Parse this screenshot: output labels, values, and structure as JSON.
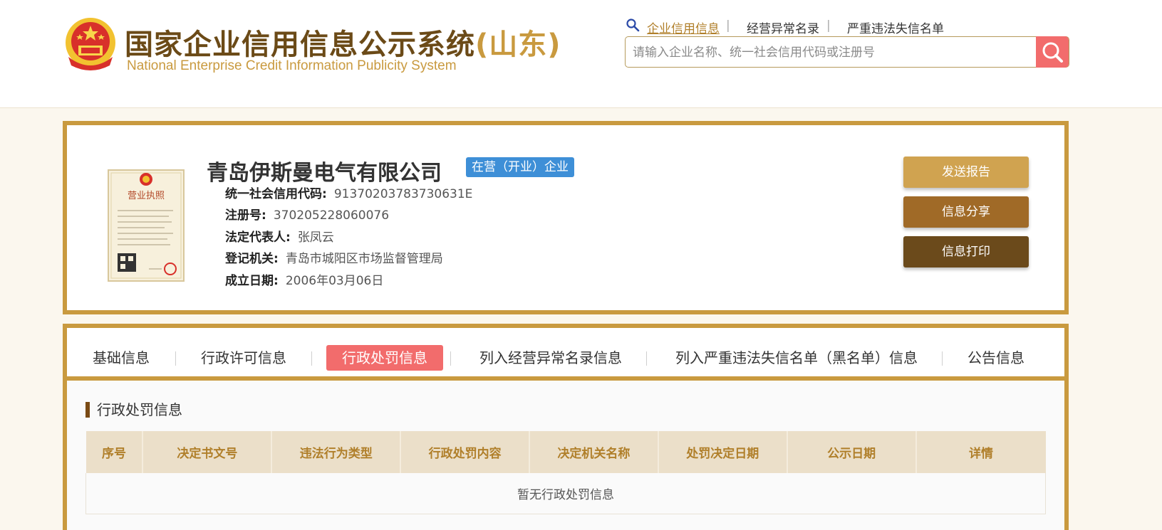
{
  "header": {
    "title": "国家企业信用信息公示系统",
    "title_province": "(山东)",
    "subtitle": "National Enterprise Credit Information Publicity System",
    "nav": [
      {
        "label": "企业信用信息",
        "active": true
      },
      {
        "label": "经营异常名录",
        "active": false
      },
      {
        "label": "严重违法失信名单",
        "active": false
      }
    ],
    "nav_sep": "|",
    "search": {
      "placeholder": "请输入企业名称、统一社会信用代码或注册号",
      "value": ""
    }
  },
  "company": {
    "name": "青岛伊斯曼电气有限公司",
    "status": "在营（开业）企业",
    "license_image_title": "营业执照",
    "fields": [
      {
        "label": "统一社会信用代码:",
        "value": "91370203783730631E"
      },
      {
        "label": "注册号:",
        "value": "370205228060076"
      },
      {
        "label": "法定代表人:",
        "value": "张凤云"
      },
      {
        "label": "登记机关:",
        "value": "青岛市城阳区市场监督管理局"
      },
      {
        "label": "成立日期:",
        "value": "2006年03月06日"
      }
    ],
    "actions": [
      {
        "label": "发送报告",
        "color": "#d0a350"
      },
      {
        "label": "信息分享",
        "color": "#a06a27"
      },
      {
        "label": "信息打印",
        "color": "#6b4a1b"
      }
    ]
  },
  "tabs": [
    {
      "label": "基础信息",
      "active": false
    },
    {
      "label": "行政许可信息",
      "active": false
    },
    {
      "label": "行政处罚信息",
      "active": true
    },
    {
      "label": "列入经营异常名录信息",
      "active": false
    },
    {
      "label": "列入严重违法失信名单（黑名单）信息",
      "active": false
    },
    {
      "label": "公告信息",
      "active": false
    }
  ],
  "section": {
    "title": "行政处罚信息",
    "columns": [
      "序号",
      "决定书文号",
      "违法行为类型",
      "行政处罚内容",
      "决定机关名称",
      "处罚决定日期",
      "公示日期",
      "详情"
    ],
    "empty_text": "暂无行政处罚信息"
  },
  "colors": {
    "gold": "#c99a3f",
    "accent_red": "#f26c6c",
    "badge_blue": "#3e8fd7",
    "brown": "#6b4a17"
  }
}
